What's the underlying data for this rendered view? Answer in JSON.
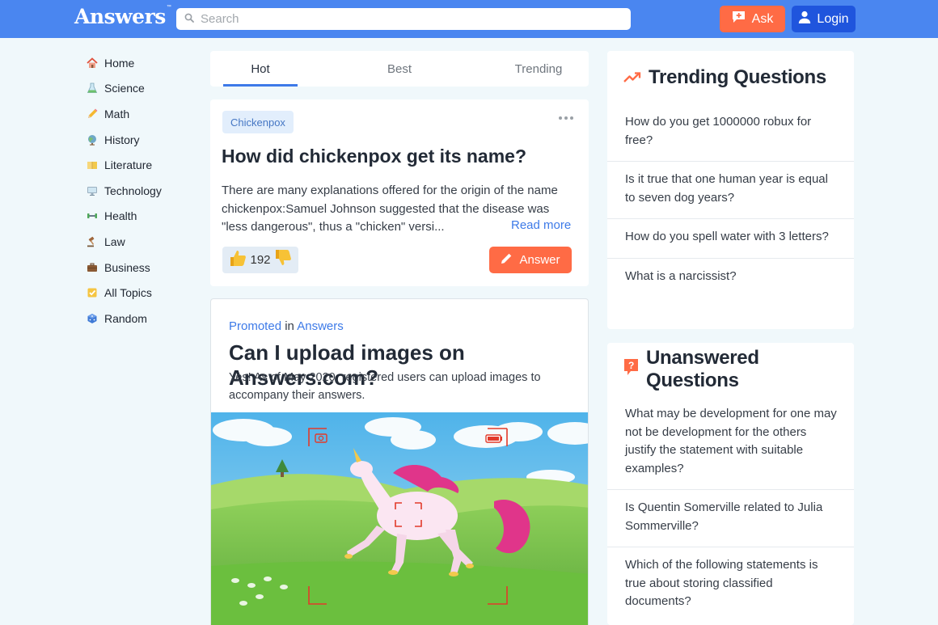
{
  "header": {
    "logo_text": "Answers",
    "logo_mark": "™",
    "search_placeholder": "Search",
    "ask_label": "Ask",
    "login_label": "Login",
    "brand_color": "#4a86f0"
  },
  "sidebar": {
    "items": [
      {
        "label": "Home",
        "icon": "house-icon"
      },
      {
        "label": "Science",
        "icon": "flask-icon"
      },
      {
        "label": "Math",
        "icon": "pencil-icon"
      },
      {
        "label": "History",
        "icon": "globe-icon"
      },
      {
        "label": "Literature",
        "icon": "book-icon"
      },
      {
        "label": "Technology",
        "icon": "monitor-icon"
      },
      {
        "label": "Health",
        "icon": "dumbbell-icon"
      },
      {
        "label": "Law",
        "icon": "gavel-icon"
      },
      {
        "label": "Business",
        "icon": "briefcase-icon"
      },
      {
        "label": "All Topics",
        "icon": "checklist-icon"
      },
      {
        "label": "Random",
        "icon": "dice-icon"
      }
    ]
  },
  "feed": {
    "tabs": [
      {
        "label": "Hot",
        "active": true
      },
      {
        "label": "Best",
        "active": false
      },
      {
        "label": "Trending",
        "active": false
      }
    ],
    "question": {
      "tag": "Chickenpox",
      "title": "How did chickenpox get its name?",
      "excerpt": "There are many explanations offered for the origin of the name chickenpox:Samuel Johnson suggested that the disease was \"less dangerous\", thus a \"chicken\" versi...",
      "read_more": "Read more",
      "votes": "192",
      "answer_label": "Answer"
    },
    "promoted": {
      "promoted_label": "Promoted",
      "in_label": "in",
      "source": "Answers",
      "title": "Can I upload images on Answers.com?",
      "text": "Yes! As of May 2020, registered users can upload images to accompany their answers."
    }
  },
  "trending": {
    "title": "Trending Questions",
    "items": [
      "How do you get 1000000 robux for free?",
      "Is it true that one human year is equal to seven dog years?",
      "How do you spell water with 3 letters?",
      "What is a narcissist?"
    ]
  },
  "unanswered": {
    "title": "Unanswered Questions",
    "items": [
      "What may be development for one may not be development for the others justify the statement with suitable examples?",
      "Is Quentin Somerville related to Julia Sommerville?",
      "Which of the following statements is true about storing classified documents?"
    ]
  },
  "colors": {
    "accent": "#ff6b45",
    "link": "#3d7ae8",
    "login": "#1f55dd"
  }
}
